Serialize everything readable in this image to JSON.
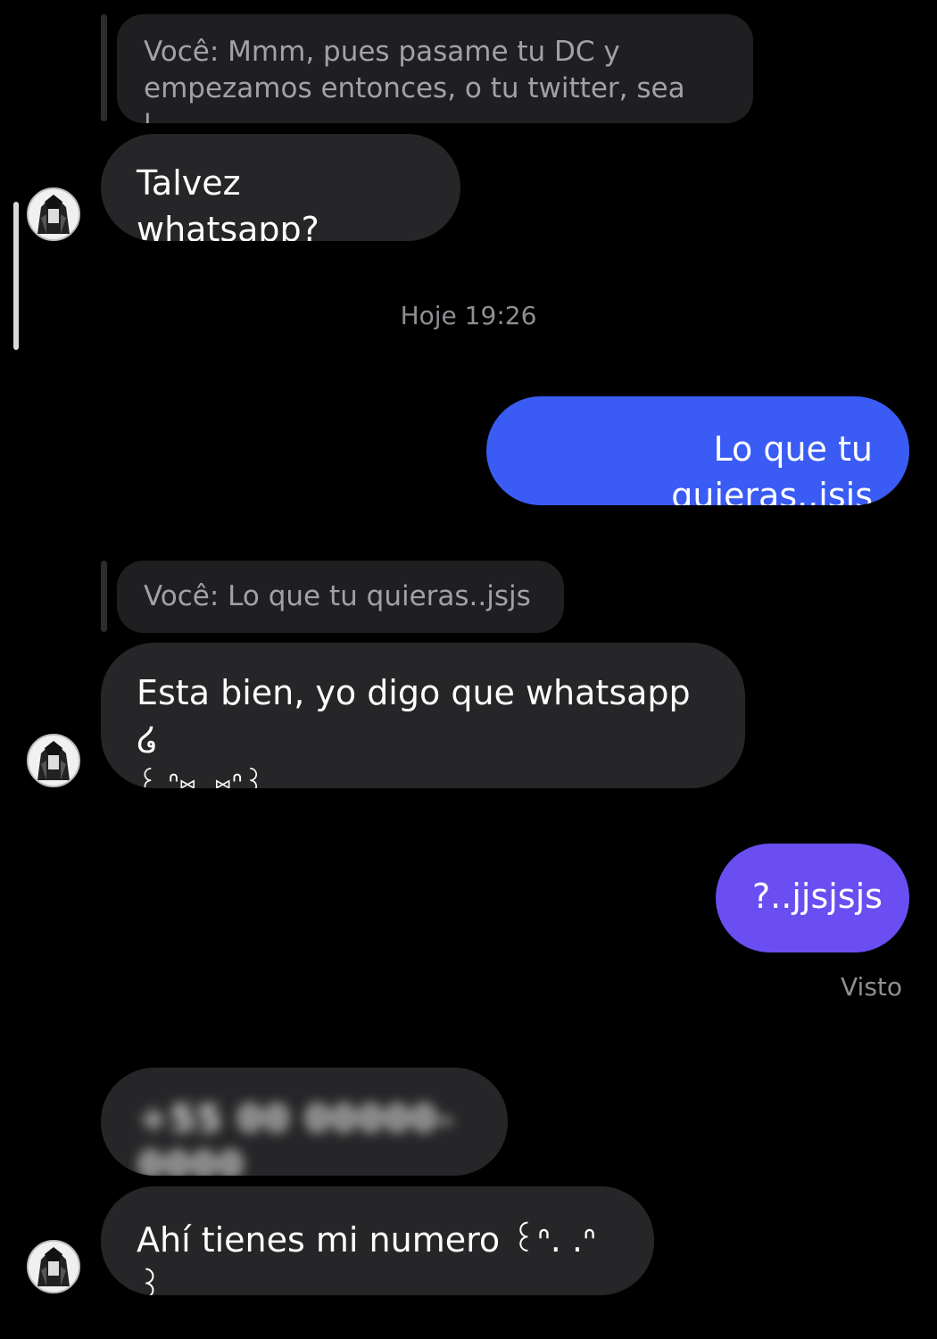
{
  "chat": {
    "messages": [
      {
        "type": "reply",
        "text": "Você: Mmm, pues pasame tu DC y empezamos entonces, o tu twitter, sea l..."
      },
      {
        "type": "incoming",
        "text": "Talvez whatsapp?"
      },
      {
        "type": "timestamp",
        "text": "Hoje 19:26"
      },
      {
        "type": "outgoing",
        "text": "Lo que tu quieras..jsjs"
      },
      {
        "type": "reply",
        "text": "Você: Lo que tu quieras..jsjs"
      },
      {
        "type": "incoming",
        "line1": "Esta bien, yo digo que whatsapp  ໒",
        "line2": "꒰ ᐢ⑅  ̫ ⑅ᐢ꒱"
      },
      {
        "type": "outgoing",
        "text": "?..jjsjsjs"
      },
      {
        "type": "status",
        "text": "Visto"
      },
      {
        "type": "incoming",
        "text": "+55 00 00000-0000",
        "blurred": true
      },
      {
        "type": "incoming",
        "text": "Ahí tienes mi numero  ꒰ᐢ. .ᐢ꒱"
      }
    ]
  },
  "colors": {
    "background": "#000000",
    "incoming_bubble": "#262628",
    "reply_bubble": "#1f1f21",
    "outgoing_blue": "#3a5cf5",
    "outgoing_purple": "#6a4ef2",
    "meta_text": "#8e8e93"
  },
  "icons": {
    "avatar": "contact-avatar-icon"
  }
}
